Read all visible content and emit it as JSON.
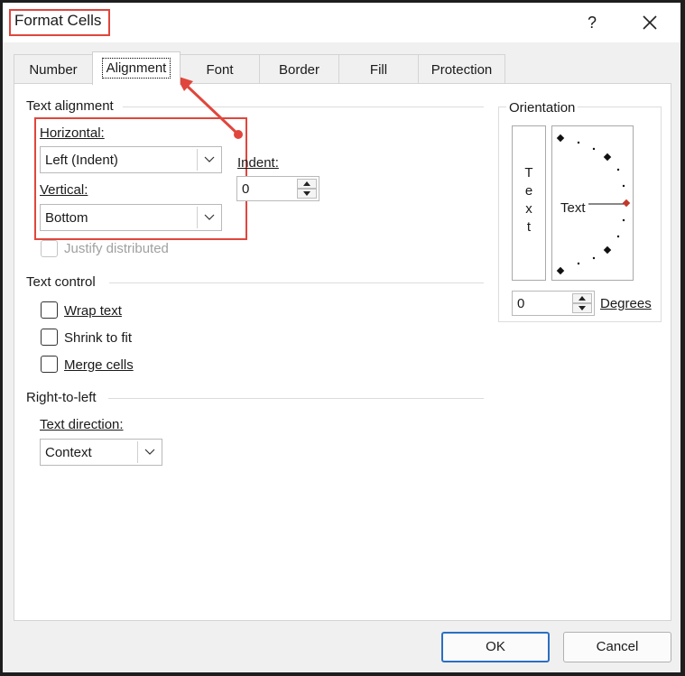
{
  "dialog": {
    "title": "Format Cells",
    "help_label": "?"
  },
  "tabs": [
    {
      "label": "Number"
    },
    {
      "label": "Alignment"
    },
    {
      "label": "Font"
    },
    {
      "label": "Border"
    },
    {
      "label": "Fill"
    },
    {
      "label": "Protection"
    }
  ],
  "text_alignment": {
    "section_title": "Text alignment",
    "horizontal_label": "Horizontal:",
    "horizontal_value": "Left (Indent)",
    "vertical_label": "Vertical:",
    "vertical_value": "Bottom",
    "indent_label": "Indent:",
    "indent_value": "0",
    "justify_distributed_label": "Justify distributed"
  },
  "text_control": {
    "section_title": "Text control",
    "wrap_text_label": "Wrap text",
    "shrink_to_fit_label": "Shrink to fit",
    "merge_cells_label": "Merge cells"
  },
  "right_to_left": {
    "section_title": "Right-to-left",
    "text_direction_label": "Text direction:",
    "text_direction_value": "Context"
  },
  "orientation": {
    "section_title": "Orientation",
    "vertical_text_letters": [
      "T",
      "e",
      "x",
      "t"
    ],
    "dial_text": "Text",
    "degrees_value": "0",
    "degrees_label": "Degrees"
  },
  "buttons": {
    "ok": "OK",
    "cancel": "Cancel"
  },
  "colors": {
    "annotation": "#e0463c",
    "default_button_border": "#2b6fc3",
    "dial_marker": "#c0392b"
  }
}
